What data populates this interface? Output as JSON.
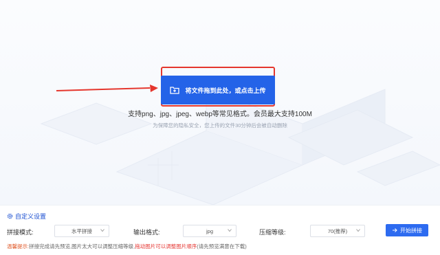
{
  "upload": {
    "button_label": "将文件拖到此处，或点击上传",
    "formats_text": "支持png、jpg、jpeg、webp等常见格式。会员最大支持100M",
    "privacy_text": "为保障您的隐私安全，您上传的文件30分钟后会被自动删除"
  },
  "settings": {
    "title": "自定义设置",
    "mode_label": "拼接模式:",
    "mode_value": "水平拼接",
    "format_label": "输出格式:",
    "format_value": "jpg",
    "compress_label": "压缩等级:",
    "compress_value": "70(推荐)",
    "start_label": "开始拼接"
  },
  "tip": {
    "prefix": "温馨提示:",
    "part1": "拼接完成请先预览,图片太大可以调整压缩等级,",
    "part2": "拖动图片可以调整图片顺序",
    "part3": "(请先预览满意在下载)"
  },
  "colors": {
    "primary": "#2463e8",
    "annotation_red": "#e5362d"
  },
  "icons": [
    "folder-upload-icon",
    "gear-icon",
    "chevron-down-icon",
    "arrow-right-icon"
  ]
}
